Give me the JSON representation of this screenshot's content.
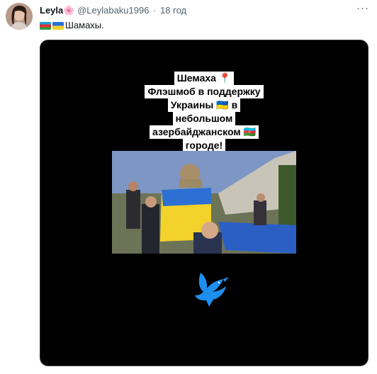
{
  "user": {
    "display_name": "Leyla",
    "name_emoji": "🌸",
    "handle": "@Leylabaku1996",
    "separator": "·",
    "time": "18 год",
    "more_label": "···"
  },
  "tweet": {
    "text": "Шамахы."
  },
  "media": {
    "caption_lines": [
      "Шемаха 📍",
      "Флэшмоб в поддержку",
      "Украины 🇺🇦 в",
      "небольшом",
      "азербайджанском 🇦🇿",
      "городе!"
    ]
  },
  "icons": {
    "avatar": "avatar-photo",
    "flag_az": "azerbaijan-flag-icon",
    "flag_ua": "ukraine-flag-icon",
    "dove": "dove-icon"
  },
  "colors": {
    "dove": "#1d8ff0",
    "ua_blue": "#2b6fd6",
    "ua_yellow": "#f7d02a"
  }
}
